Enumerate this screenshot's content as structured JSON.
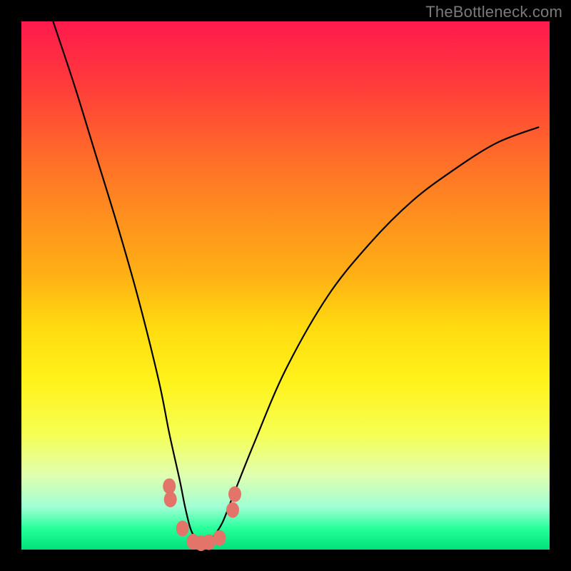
{
  "watermark": "TheBottleneck.com",
  "chart_data": {
    "type": "line",
    "title": "",
    "xlabel": "",
    "ylabel": "",
    "xlim": [
      0,
      100
    ],
    "ylim": [
      0,
      100
    ],
    "background_gradient": [
      "#ff1a4d",
      "#ff6a2a",
      "#ffdb10",
      "#fff21a",
      "#26ff9a",
      "#00e07a"
    ],
    "series": [
      {
        "name": "bottleneck-curve",
        "x": [
          6,
          10,
          14,
          18,
          22,
          26,
          28,
          30,
          31,
          32,
          33,
          34,
          35,
          36,
          38,
          40,
          44,
          50,
          58,
          66,
          74,
          82,
          90,
          98
        ],
        "y": [
          100,
          88,
          75,
          62,
          48,
          32,
          22,
          13,
          8,
          4,
          2,
          1,
          1,
          2,
          5,
          10,
          20,
          34,
          48,
          58,
          66,
          72,
          77,
          80
        ]
      }
    ],
    "markers": {
      "name": "highlight-points",
      "points": [
        {
          "x": 28.0,
          "y": 12.0
        },
        {
          "x": 28.2,
          "y": 9.5
        },
        {
          "x": 30.5,
          "y": 4.0
        },
        {
          "x": 32.5,
          "y": 1.5
        },
        {
          "x": 34.0,
          "y": 1.2
        },
        {
          "x": 35.5,
          "y": 1.4
        },
        {
          "x": 37.5,
          "y": 2.2
        },
        {
          "x": 40.0,
          "y": 7.5
        },
        {
          "x": 40.4,
          "y": 10.5
        }
      ]
    }
  }
}
